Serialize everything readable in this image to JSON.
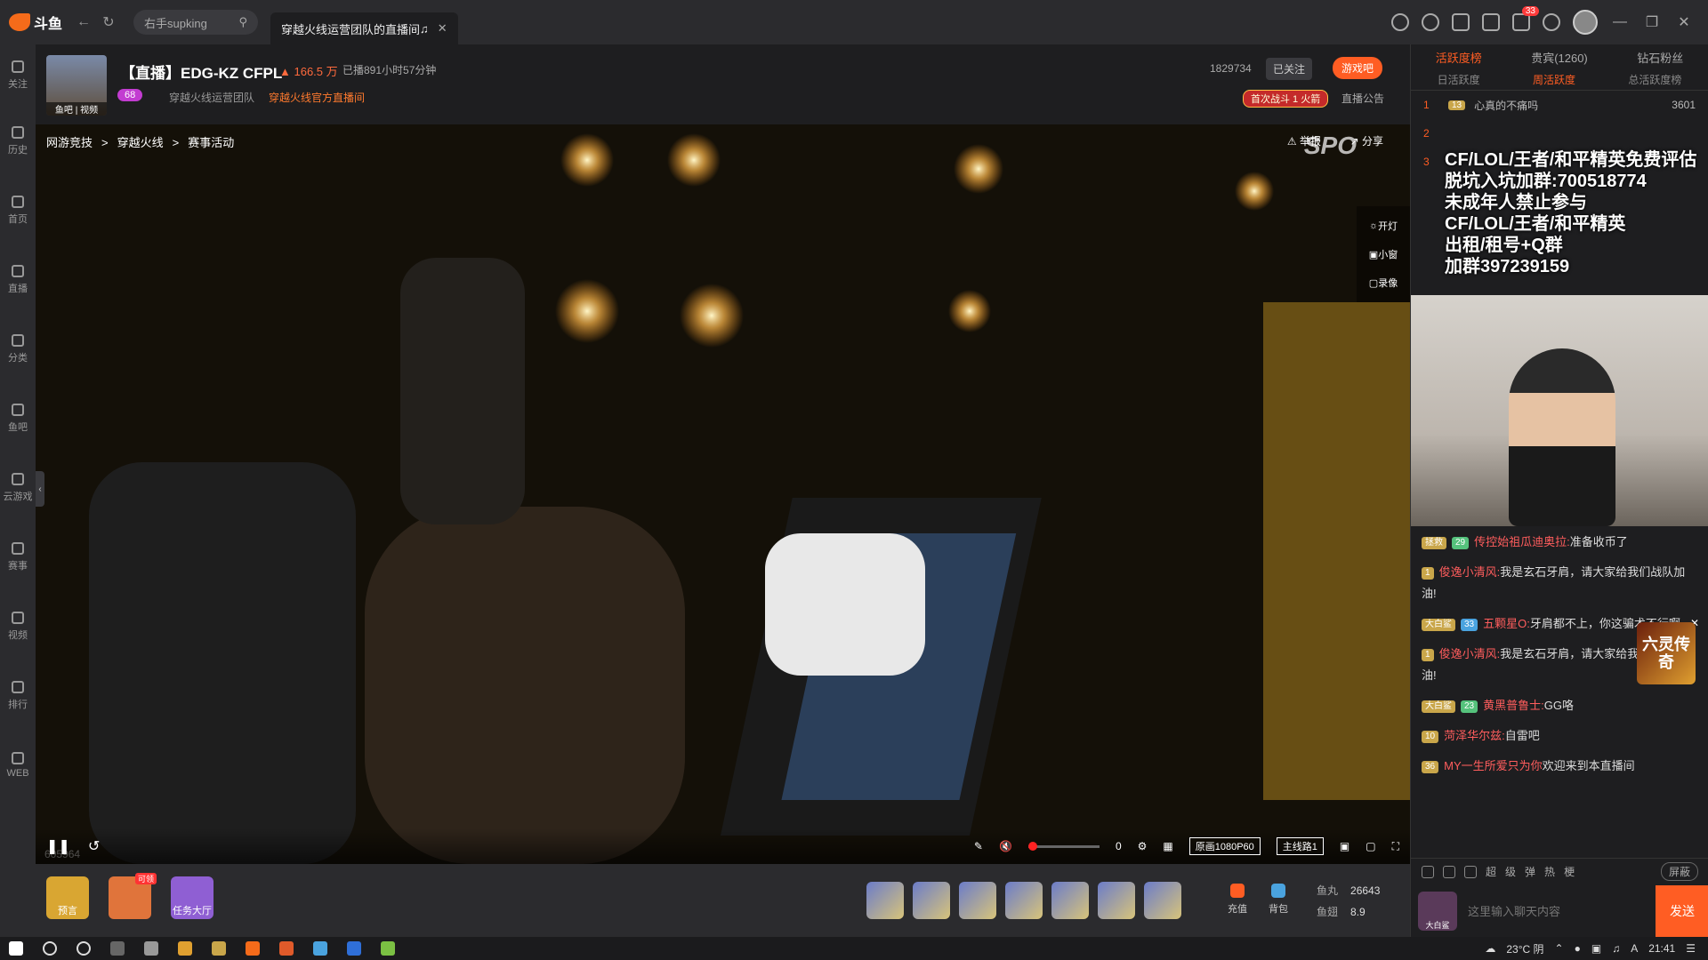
{
  "titlebar": {
    "brand": "斗鱼",
    "search_text": "右手supking",
    "tab_title": "穿越火线运营团队的直播间",
    "notify_count": "33"
  },
  "sidebar": {
    "items": [
      "关注",
      "历史",
      "首页",
      "直播",
      "分类",
      "鱼吧",
      "云游戏",
      "赛事",
      "视频",
      "排行",
      "WEB"
    ]
  },
  "stream": {
    "thumb_label": "鱼吧 | 视频",
    "title": "【直播】EDG-KZ CFPL",
    "hot": "166.5 万",
    "duration": "已播891小时57分钟",
    "level": "68",
    "team": "穿越火线运营团队",
    "official": "穿越火线官方直播间",
    "room_id": "1829734",
    "follow_label": "已关注",
    "game_btn": "游戏吧",
    "first_fight": "首次战斗 1 火箭",
    "announce": "直播公告"
  },
  "video": {
    "crumbs": [
      "网游竞技",
      ">",
      "穿越火线",
      ">",
      "赛事活动"
    ],
    "report": "举报",
    "share": "分享",
    "watermark": "SPO",
    "side_tools": [
      "开灯",
      "小窗",
      "录像"
    ],
    "uid": "605964",
    "volume": "0",
    "quality": "原画1080P60",
    "line": "主线路1"
  },
  "bottom": {
    "cards": [
      {
        "label": "预言",
        "color": "#d9a632"
      },
      {
        "label": "",
        "color": "#e0743b",
        "tag": "可领"
      },
      {
        "label": "任务大厅",
        "color": "#8f5fd3"
      }
    ],
    "recharge": "充值",
    "bag": "背包",
    "fishball_label": "鱼丸",
    "fishball": "26643",
    "fishfin_label": "鱼翅",
    "fishfin": "8.9"
  },
  "ranking": {
    "tabs": [
      "活跃度榜",
      "贵宾(1260)",
      "钻石粉丝"
    ],
    "subtabs": [
      "日活跃度",
      "周活跃度",
      "总活跃度榜"
    ],
    "rows": [
      {
        "n": "1",
        "badge": "13",
        "name": "心真的不痛吗",
        "score": "3601"
      },
      {
        "n": "2",
        "badge": "",
        "name": "",
        "score": ""
      },
      {
        "n": "3",
        "badge": "",
        "name": "",
        "score": ""
      }
    ]
  },
  "overlay": "CF/LOL/王者/和平精英免费评估\n脱坑入坑加群:700518774\n未成年人禁止参与\nCF/LOL/王者/和平精英\n出租/租号+Q群\n加群397239159",
  "chat": {
    "messages": [
      {
        "badge": "拯救",
        "lv": "29",
        "lvtype": "g",
        "name": "传控始祖瓜迪奥拉:",
        "text": "准备收币了"
      },
      {
        "badge": "1",
        "lv": "",
        "lvtype": "",
        "name": "俊逸小清风:",
        "text": "我是玄石牙肩，请大家给我们战队加油!"
      },
      {
        "badge": "大白鲨",
        "lv": "33",
        "lvtype": "b",
        "name": "五颗星O:",
        "text": "牙肩都不上，你这骗术不行啊"
      },
      {
        "badge": "1",
        "lv": "",
        "lvtype": "",
        "name": "俊逸小清风:",
        "text": "我是玄石牙肩，请大家给我们战队加油!"
      },
      {
        "badge": "大白鲨",
        "lv": "23",
        "lvtype": "g",
        "name": "黄黑普鲁士:",
        "text": "GG咯"
      },
      {
        "badge": "10",
        "lv": "",
        "lvtype": "",
        "name": "菏泽华尔兹:",
        "text": "自雷吧"
      },
      {
        "badge": "36",
        "lv": "",
        "lvtype": "b",
        "name": "MY一生所爱只为你",
        "text": "欢迎来到本直播间"
      }
    ],
    "ad_text": "六灵传奇",
    "shield": "屏蔽",
    "tools": [
      "超",
      "级",
      "弹",
      "热",
      "梗"
    ],
    "input_placeholder": "这里输入聊天内容",
    "send": "发送",
    "my_badge": "大白鲨"
  },
  "taskbar": {
    "weather": "23°C 阴",
    "ime": "A",
    "time": "21:41"
  }
}
